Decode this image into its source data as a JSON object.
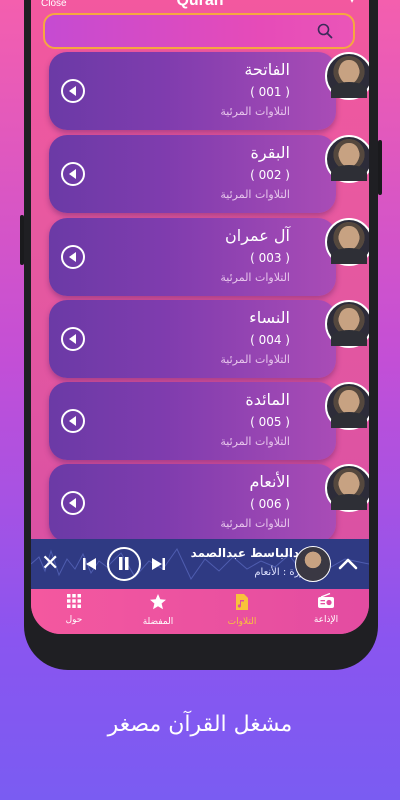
{
  "topbar": {
    "close_label": "Close",
    "app_title": "Quran"
  },
  "search": {
    "placeholder": ""
  },
  "surahs": [
    {
      "name": "الفاتحة",
      "number": "( 001 )",
      "subtitle": "التلاوات المرئية"
    },
    {
      "name": "البقرة",
      "number": "( 002 )",
      "subtitle": "التلاوات المرئية"
    },
    {
      "name": "آل عمران",
      "number": "( 003 )",
      "subtitle": "التلاوات المرئية"
    },
    {
      "name": "النساء",
      "number": "( 004 )",
      "subtitle": "التلاوات المرئية"
    },
    {
      "name": "المائدة",
      "number": "( 005 )",
      "subtitle": "التلاوات المرئية"
    },
    {
      "name": "الأنعام",
      "number": "( 006 )",
      "subtitle": "التلاوات المرئية"
    }
  ],
  "player": {
    "reciter": "عبدالباسط عبدالصمد",
    "current": "سورة : الأنعام"
  },
  "nav": [
    {
      "label": "حول",
      "icon": "grid-icon"
    },
    {
      "label": "المفضلة",
      "icon": "star-icon"
    },
    {
      "label": "التلاوات",
      "icon": "music-file-icon",
      "active": true
    },
    {
      "label": "الإذاعة",
      "icon": "radio-icon"
    }
  ],
  "caption": "مشغل القرآن مصغر",
  "colors": {
    "accent": "#f8c33b",
    "card": "#7f3cae",
    "player": "#2f3a83"
  }
}
